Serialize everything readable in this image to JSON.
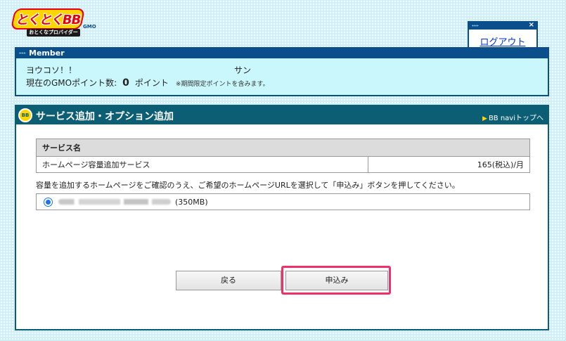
{
  "logo": {
    "main_text": "とくとくBB",
    "sub_text": "おとくなプロバイダー",
    "gmo_text": "GMO"
  },
  "logout": {
    "label": "ログアウト",
    "close_glyph": "×"
  },
  "member": {
    "title": "Member",
    "greeting": "ヨウコソ！！",
    "name_suffix": "サン",
    "points_label": "現在のGMOポイント数:",
    "points_value": "0",
    "points_unit": "ポイント",
    "points_note": "※期間限定ポイントを含みます。"
  },
  "main": {
    "badge_text": "BB",
    "title": "サービス追加・オプション追加",
    "navi_link": "BB naviトップへ",
    "table": {
      "header": "サービス名",
      "rows": [
        {
          "name": "ホームページ容量追加サービス",
          "price": "165(税込)/月"
        }
      ]
    },
    "instruction": "容量を追加するホームページをご確認のうえ、ご希望のホームページURLを選択して「申込み」ボタンを押してください。",
    "url_option": {
      "size": "(350MB)",
      "selected": true
    },
    "buttons": {
      "back": "戻る",
      "apply": "申込み"
    }
  },
  "colors": {
    "header_navy": "#0b4e8c",
    "header_teal": "#0b5e73",
    "member_bg": "#c9f7fb",
    "highlight": "#f0306a",
    "link": "#0033cc"
  }
}
